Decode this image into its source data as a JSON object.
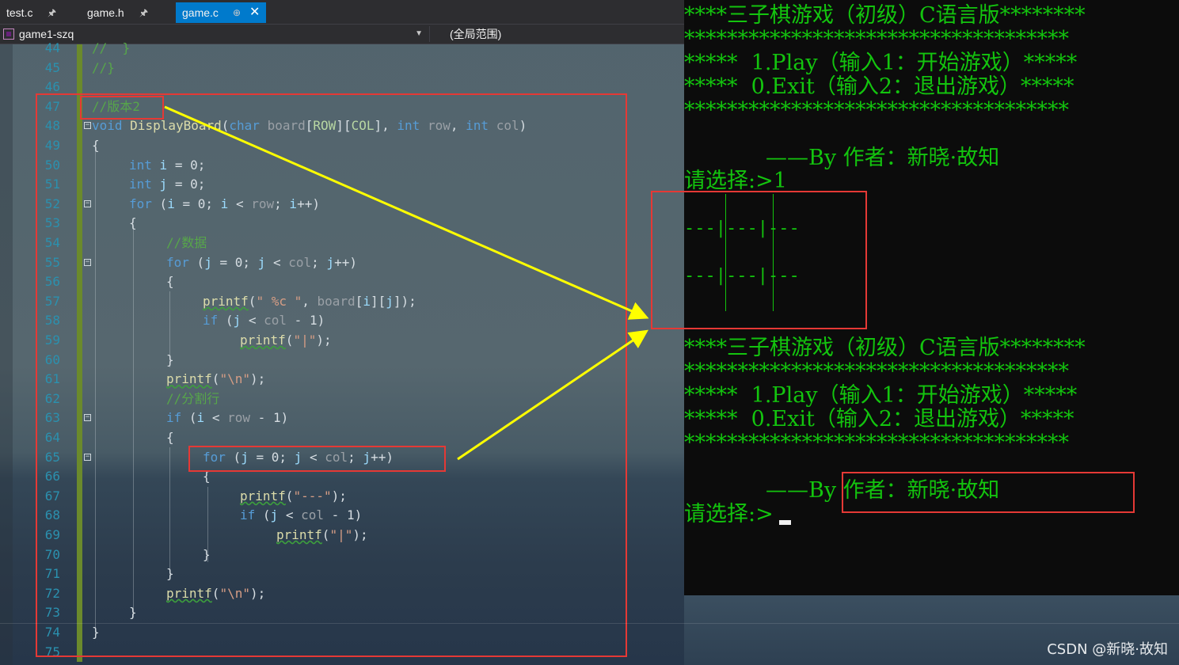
{
  "tabs": [
    {
      "label": "test.c",
      "pin": "🖈",
      "active": false
    },
    {
      "label": "game.h",
      "pin": "🖈",
      "active": false
    },
    {
      "label": "game.c",
      "pin": "⊕",
      "active": true,
      "close": "✕"
    }
  ],
  "nav": {
    "project": "game1-szq",
    "scope": "(全局范围)"
  },
  "code_lines": [
    {
      "n": "44",
      "text": "//  }"
    },
    {
      "n": "45",
      "text": "//}"
    },
    {
      "n": "46",
      "text": ""
    },
    {
      "n": "47",
      "text": "//版本2"
    },
    {
      "n": "48",
      "text": "void DisplayBoard(char board[ROW][COL], int row, int col)"
    },
    {
      "n": "49",
      "text": "{"
    },
    {
      "n": "50",
      "text": "int i = 0;"
    },
    {
      "n": "51",
      "text": "int j = 0;"
    },
    {
      "n": "52",
      "text": "for (i = 0; i < row; i++)"
    },
    {
      "n": "53",
      "text": "{"
    },
    {
      "n": "54",
      "text": "//数据"
    },
    {
      "n": "55",
      "text": "for (j = 0; j < col; j++)"
    },
    {
      "n": "56",
      "text": "{"
    },
    {
      "n": "57",
      "text": "printf(\" %c \", board[i][j]);"
    },
    {
      "n": "58",
      "text": "if (j < col - 1)"
    },
    {
      "n": "59",
      "text": "printf(\"|\");"
    },
    {
      "n": "60",
      "text": "}"
    },
    {
      "n": "61",
      "text": "printf(\"\\n\");"
    },
    {
      "n": "62",
      "text": "//分割行"
    },
    {
      "n": "63",
      "text": "if (i < row - 1)"
    },
    {
      "n": "64",
      "text": "{"
    },
    {
      "n": "65",
      "text": "for (j = 0; j < col; j++)"
    },
    {
      "n": "66",
      "text": "{"
    },
    {
      "n": "67",
      "text": "printf(\"---\");"
    },
    {
      "n": "68",
      "text": "if (j < col - 1)"
    },
    {
      "n": "69",
      "text": "printf(\"|\");"
    },
    {
      "n": "70",
      "text": "}"
    },
    {
      "n": "71",
      "text": "}"
    },
    {
      "n": "72",
      "text": "printf(\"\\n\");"
    },
    {
      "n": "73",
      "text": "}"
    },
    {
      "n": "74",
      "text": "}"
    },
    {
      "n": "75",
      "text": ""
    }
  ],
  "console": {
    "menu1": [
      "****三子棋游戏（初级）C语言版********",
      "************************************",
      "*****  1.Play（输入1：开始游戏）*****",
      "*****  0.Exit（输入2：退出游戏）*****",
      "************************************",
      "",
      "            ——By 作者：新晓·故知"
    ],
    "prompt1": "请选择:>1",
    "board_rows": [
      "---|---|---",
      "---|---|---"
    ],
    "menu2": [
      "****三子棋游戏（初级）C语言版********",
      "************************************",
      "*****  1.Play（输入1：开始游戏）*****",
      "*****  0.Exit（输入2：退出游戏）*****",
      "************************************",
      "",
      "            ——By 作者：新晓·故知"
    ],
    "prompt2": "请选择:>"
  },
  "watermark": "CSDN @新晓·故知",
  "colors": {
    "console_text": "#13c40e",
    "annotation_red": "#e53935",
    "arrow_yellow": "#ffff00"
  }
}
